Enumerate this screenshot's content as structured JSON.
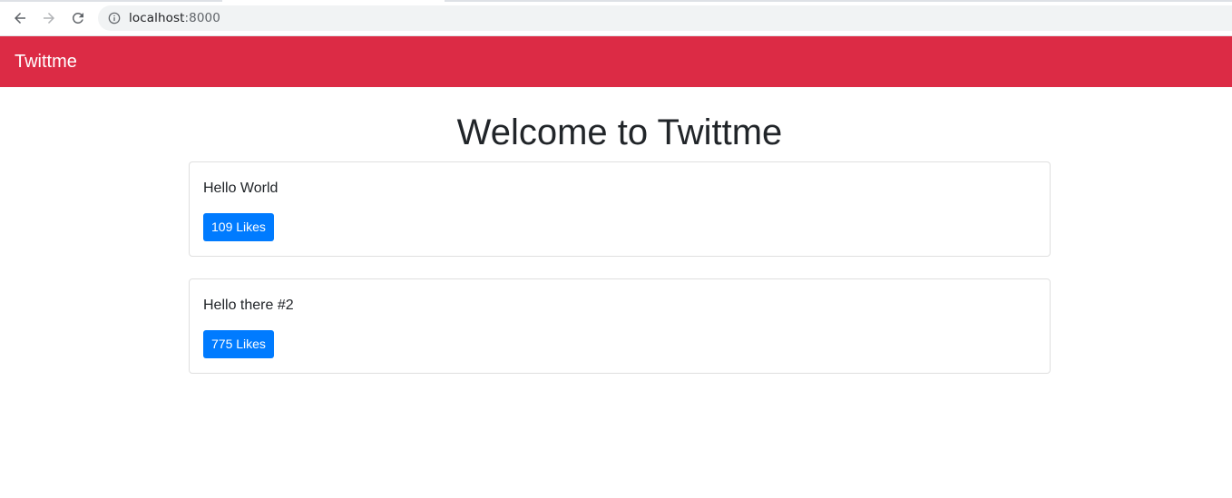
{
  "browser": {
    "url_host": "localhost",
    "url_port": ":8000",
    "icons": {
      "back": "arrow-left-icon",
      "forward": "arrow-right-icon",
      "reload": "reload-icon",
      "site_info": "info-icon"
    }
  },
  "navbar": {
    "brand": "Twittme",
    "color": "#dc2b45"
  },
  "main": {
    "title": "Welcome to Twittme",
    "tweets": [
      {
        "content": "Hello World",
        "likes_label": "109 Likes"
      },
      {
        "content": "Hello there #2",
        "likes_label": "775 Likes"
      }
    ]
  },
  "colors": {
    "accent_button": "#007bff",
    "card_border": "#dfdfdf"
  }
}
